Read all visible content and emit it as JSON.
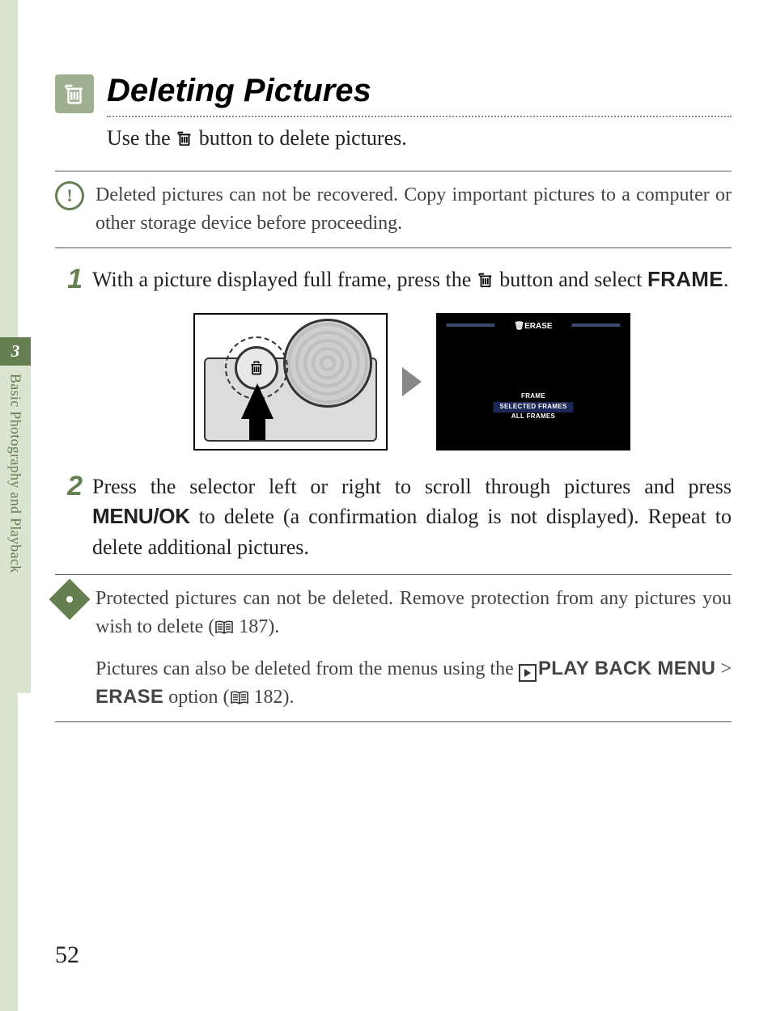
{
  "chapter": {
    "number": "3",
    "label": "Basic Photography and Playback"
  },
  "title": "Deleting Pictures",
  "trash_icon_name": "trash-icon",
  "intro": {
    "pre": "Use the ",
    "post": " button to delete pictures."
  },
  "caution": "Deleted pictures can not be recovered. Copy important pictures to a computer or other storage device before proceeding.",
  "steps": {
    "s1": {
      "num": "1",
      "pre": "With a picture displayed full frame, press the ",
      "post": " button and select ",
      "bold": "FRAME",
      "period": "."
    },
    "s2": {
      "num": "2",
      "pre": "Press the selector left or right to scroll through pictures and press ",
      "bold": "MENU/OK",
      "post": " to delete (a confirmation dialog is not displayed). Repeat to delete additional pictures."
    }
  },
  "erase_screen": {
    "title": "ERASE",
    "opt1": "FRAME",
    "opt2": "SELECTED FRAMES",
    "opt3": "ALL FRAMES"
  },
  "notes": {
    "n1": {
      "pre": "Protected pictures can not be deleted. Remove protection from any pictures you wish to delete (",
      "ref": " 187).",
      "ref_prefix": ""
    },
    "n2": {
      "pre": "Pictures can also be deleted from the menus using the ",
      "pbmenu": "PLAY BACK MENU",
      "gt": " > ",
      "erase": "ERASE",
      "post": " option (",
      "ref": " 182)."
    }
  },
  "page_number": "52"
}
